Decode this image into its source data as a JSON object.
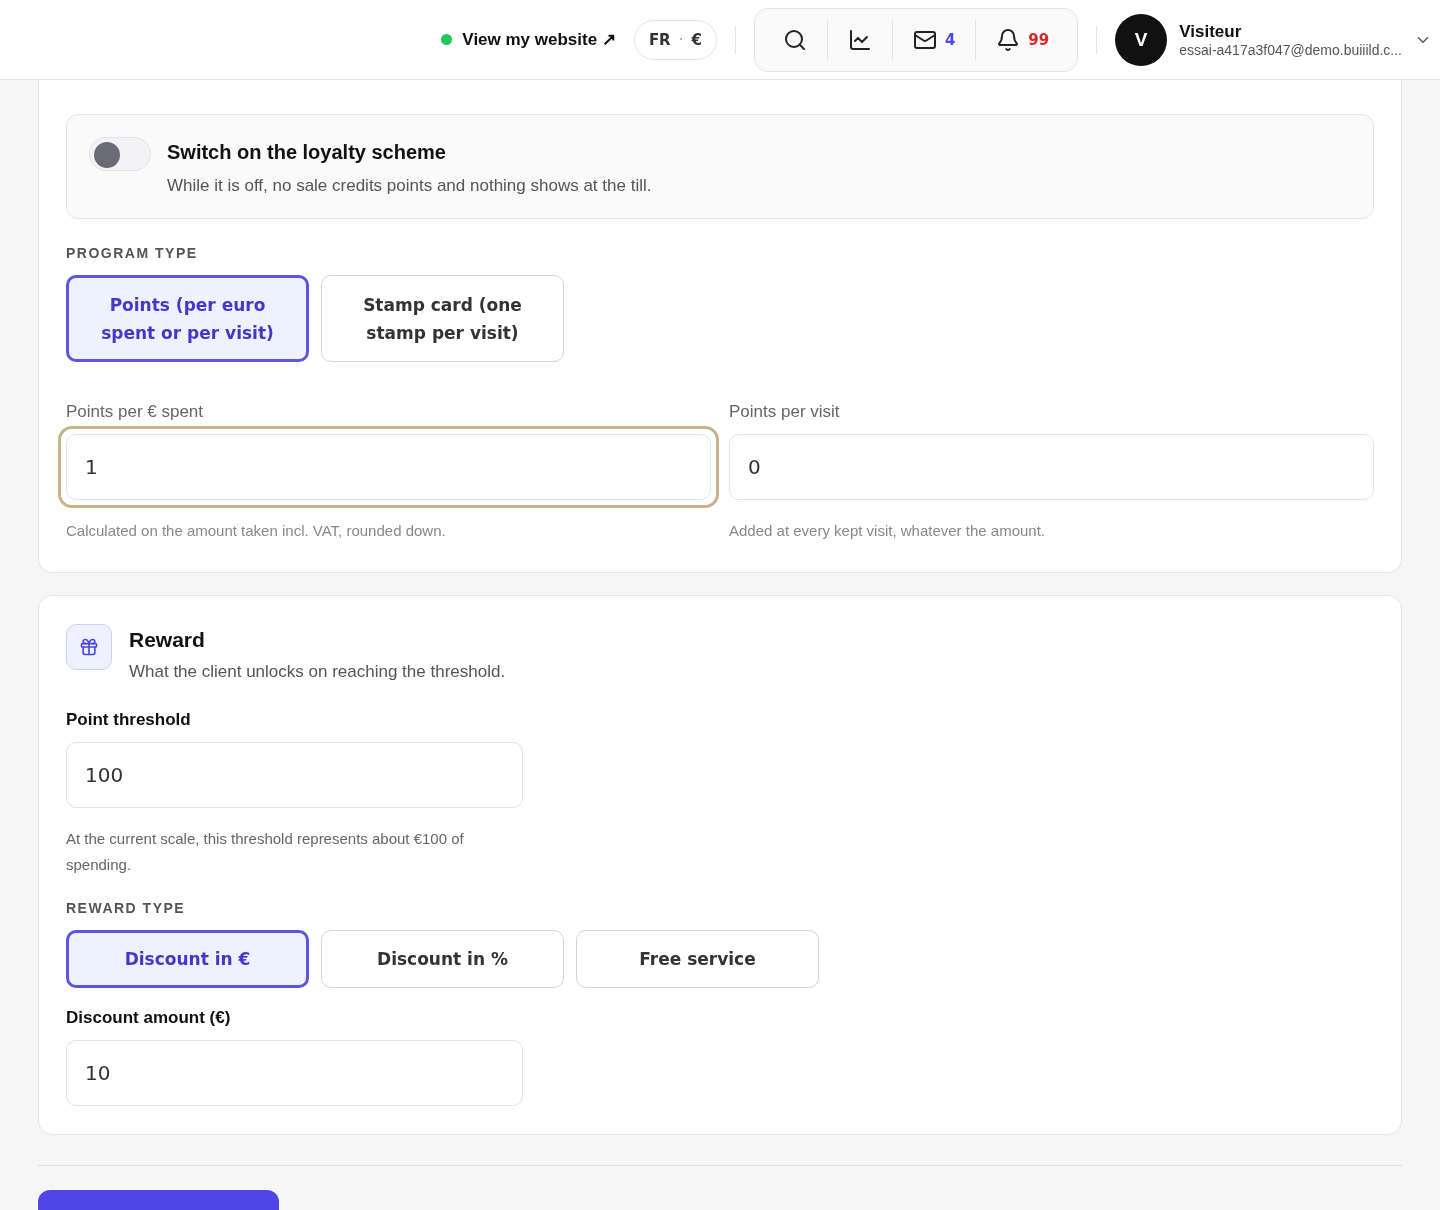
{
  "header": {
    "site_link": {
      "label": "View my website ↗",
      "online": true
    },
    "locale": {
      "language": "FR",
      "separator": "·",
      "currency": "€"
    },
    "tools": [
      {
        "kind": "search"
      },
      {
        "kind": "chart"
      },
      {
        "kind": "mail",
        "count": "4"
      },
      {
        "kind": "bell",
        "count": "99"
      }
    ],
    "user": {
      "initial": "V",
      "name": "Visiteur",
      "email": "essai-a417a3f047@demo.buiiild.c..."
    }
  },
  "scale_card": {
    "toggle": {
      "on": false,
      "title": "Switch on the loyalty scheme",
      "description": "While it is off, no sale credits points and nothing shows at the till."
    },
    "program_type": {
      "label": "PROGRAM TYPE",
      "options": [
        {
          "label": "Points (per euro spent or per visit)",
          "selected": true
        },
        {
          "label": "Stamp card (one stamp per visit)",
          "selected": false
        }
      ]
    },
    "fields": [
      {
        "label": "Points per € spent",
        "value": "1",
        "focused": true,
        "hint": "Calculated on the amount taken incl. VAT, rounded down."
      },
      {
        "label": "Points per visit",
        "value": "0",
        "focused": false,
        "hint": "Added at every kept visit, whatever the amount."
      }
    ]
  },
  "reward_card": {
    "title": "Reward",
    "subtitle": "What the client unlocks on reaching the threshold.",
    "threshold": {
      "label": "Point threshold",
      "value": "100",
      "hint": "At the current scale, this threshold represents about €100 of spending."
    },
    "reward_type": {
      "label": "REWARD TYPE",
      "options": [
        {
          "label": "Discount in €",
          "selected": true
        },
        {
          "label": "Discount in %",
          "selected": false
        },
        {
          "label": "Free service",
          "selected": false
        }
      ]
    },
    "amount": {
      "label": "Discount amount (€)",
      "value": "10"
    }
  }
}
